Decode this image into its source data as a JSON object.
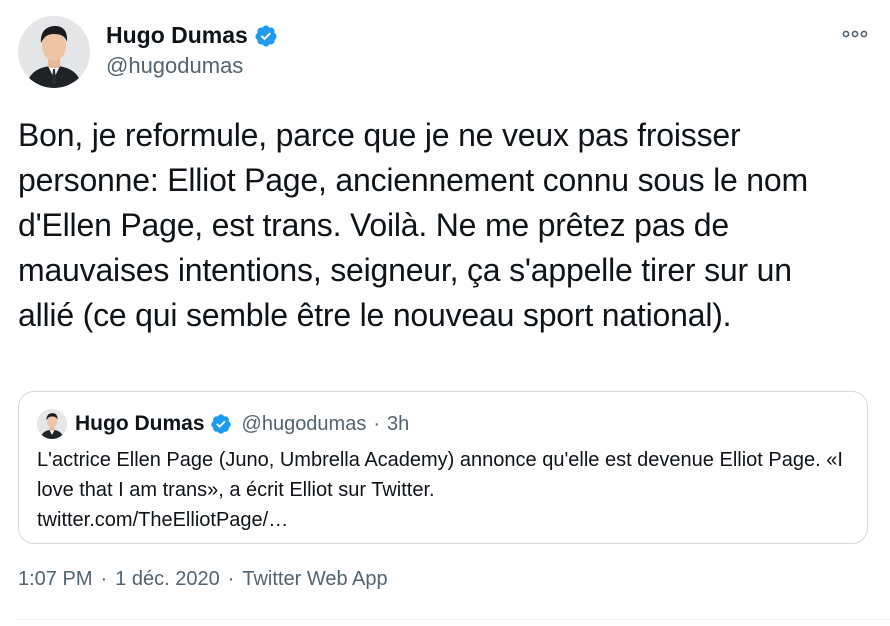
{
  "author": {
    "name": "Hugo Dumas",
    "handle": "@hugodumas",
    "verified": true,
    "avatar_icon": "profile-photo"
  },
  "menu": {
    "icon": "more-horizontal-icon"
  },
  "tweet": {
    "text": "Bon, je reformule, parce que je ne veux pas froisser personne: Elliot Page, anciennement connu sous le nom d'Ellen Page, est trans. Voilà. Ne me prêtez pas de mauvaises intentions, seigneur, ça s'appelle tirer sur un allié (ce qui semble être le nouveau sport national)."
  },
  "quoted": {
    "name": "Hugo Dumas",
    "handle": "@hugodumas",
    "separator": "·",
    "time": "3h",
    "text": "L'actrice Ellen Page (Juno, Umbrella Academy) annonce qu'elle est devenue Elliot Page. «I love that I am trans», a écrit Elliot sur Twitter.",
    "link": "twitter.com/TheElliotPage/…"
  },
  "footer": {
    "time": "1:07 PM",
    "separator": "·",
    "date": "1 déc. 2020",
    "source": "Twitter Web App"
  },
  "colors": {
    "text": "#0f1419",
    "secondary": "#536471",
    "verified": "#1d9bf0",
    "border": "#cfd9de"
  }
}
